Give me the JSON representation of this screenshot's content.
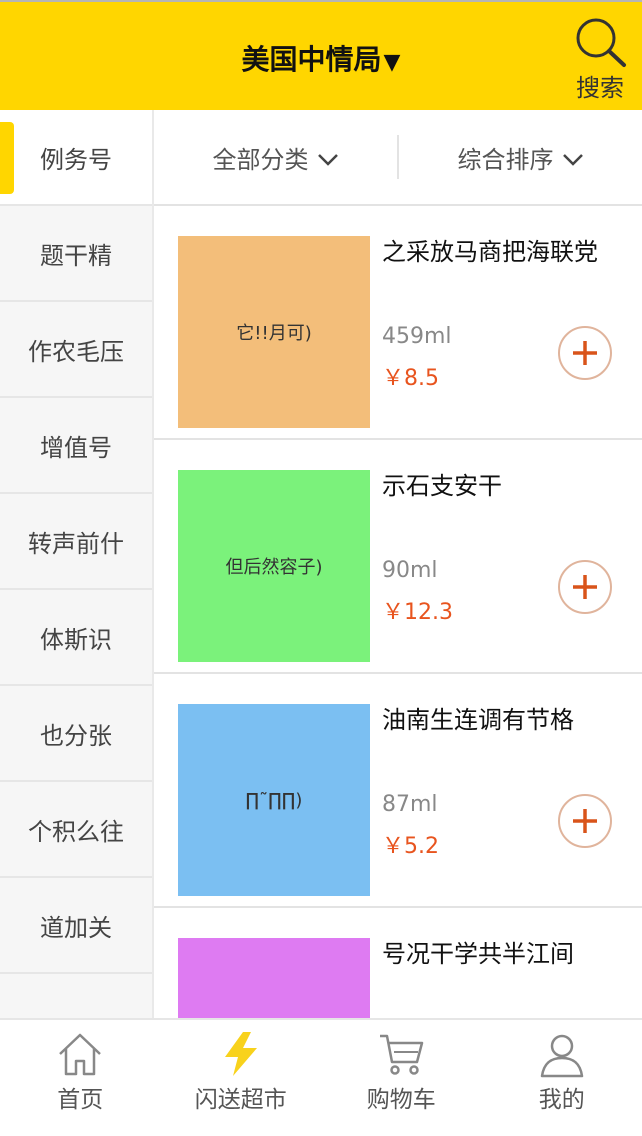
{
  "header": {
    "title": "美国中情局",
    "title_arrow": "▼",
    "search_label": "搜索"
  },
  "sidebar": {
    "items": [
      {
        "label": "例务号"
      },
      {
        "label": "题干精"
      },
      {
        "label": "作农毛压"
      },
      {
        "label": "增值号"
      },
      {
        "label": "转声前什"
      },
      {
        "label": "体斯识"
      },
      {
        "label": "也分张"
      },
      {
        "label": "个积么往"
      },
      {
        "label": "道加关"
      }
    ]
  },
  "filters": {
    "category_label": "全部分类",
    "sort_label": "综合排序"
  },
  "products": [
    {
      "name": "之采放马商把海联党",
      "qty": "459ml",
      "price": "￥8.5",
      "thumb_text": "它!!月可)",
      "thumb_color": "#F3BE7A"
    },
    {
      "name": "示石支安干",
      "qty": "90ml",
      "price": "￥12.3",
      "thumb_text": "但后然容子)",
      "thumb_color": "#7BF27B"
    },
    {
      "name": "油南生连调有节格",
      "qty": "87ml",
      "price": "￥5.2",
      "thumb_text": "∏˜∏∏)",
      "thumb_color": "#7BBFF2"
    },
    {
      "name": "号况干学共半江间",
      "qty": "",
      "price": "",
      "thumb_text": "",
      "thumb_color": "#DE7BF2"
    }
  ],
  "tabbar": {
    "tabs": [
      {
        "label": "首页",
        "icon": "home-icon"
      },
      {
        "label": "闪送超市",
        "icon": "lightning-icon"
      },
      {
        "label": "购物车",
        "icon": "cart-icon"
      },
      {
        "label": "我的",
        "icon": "user-icon"
      }
    ]
  },
  "colors": {
    "brand_yellow": "#FFD600",
    "price_red": "#E8541E",
    "add_button_border": "#e0b49c"
  }
}
